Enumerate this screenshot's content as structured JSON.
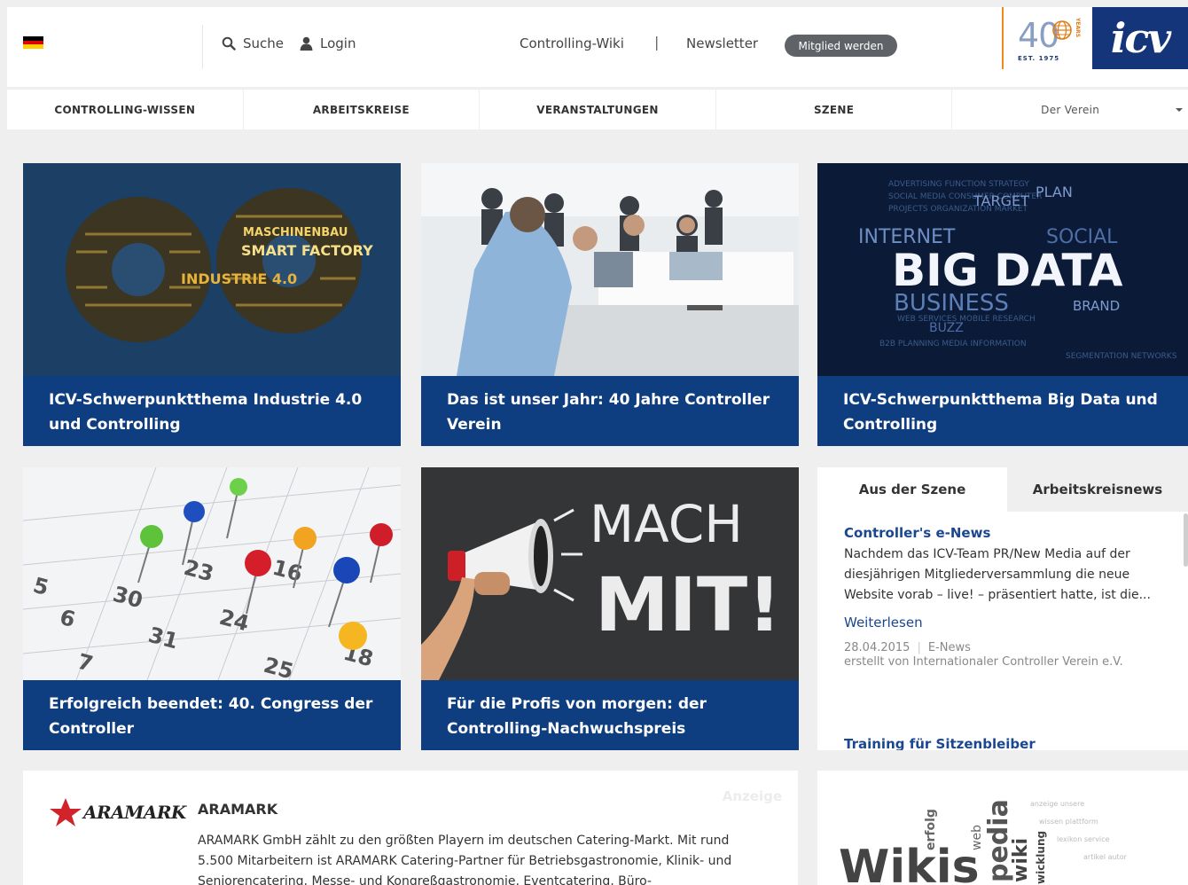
{
  "topbar": {
    "search_label": "Suche",
    "login_label": "Login",
    "wiki_label": "Controlling-Wiki",
    "pipe": "|",
    "newsletter_label": "Newsletter",
    "join_label": "Mitglied werden",
    "logo40": {
      "number": "40",
      "years": "YEARS",
      "est": "EST. 1975"
    },
    "logo_icv": "icv",
    "flag_colors": [
      "#000000",
      "#dd0000",
      "#ffce00"
    ]
  },
  "nav": {
    "items": [
      {
        "label": "CONTROLLING-WISSEN"
      },
      {
        "label": "ARBEITSKREISE"
      },
      {
        "label": "VERANSTALTUNGEN"
      },
      {
        "label": "SZENE"
      },
      {
        "label": "Der Verein"
      }
    ]
  },
  "tiles": [
    {
      "caption": "ICV-Schwerpunktthema Industrie 4.0 und Controlling",
      "image": "gears-word-cloud"
    },
    {
      "caption": "Das ist unser Jahr: 40 Jahre Controller Verein",
      "image": "meeting-photo"
    },
    {
      "caption": "ICV-Schwerpunktthema Big Data und Controlling",
      "image": "big-data-word-cloud"
    },
    {
      "caption": "Erfolgreich beendet: 40. Congress der Controller",
      "image": "calendar-pins"
    },
    {
      "caption": "Für die Profis von morgen: der Controlling-Nachwuchspreis",
      "image": "megaphone-chalkboard"
    }
  ],
  "images": {
    "gears_words": [
      "MASCHINENBAU",
      "SMART FACTORY",
      "INDUSTRIE 4.0"
    ],
    "bigdata_words": [
      "INTERNET",
      "BIG DATA",
      "BUSINESS",
      "TARGET",
      "PLAN",
      "SOCIAL",
      "BRAND",
      "BUZZ"
    ],
    "chalk_words": [
      "MACH",
      "MIT!"
    ],
    "wiki_words": [
      "Wikis",
      "pedia",
      "wiki",
      "erfolg",
      "web",
      "wicklung"
    ]
  },
  "news": {
    "tabs": [
      {
        "label": "Aus der Szene"
      },
      {
        "label": "Arbeitskreisnews"
      }
    ],
    "item1": {
      "title": "Controller's e-News",
      "text": "Nachdem das ICV-Team PR/New Media auf der diesjährigen Mitgliederversammlung die neue Website vorab – live! – präsentiert hatte, ist die...",
      "more": "Weiterlesen",
      "date": "28.04.2015",
      "category": "E-News",
      "author": "erstellt von Internationaler Controller Verein e.V."
    },
    "item2": {
      "title": "Training für Sitzenbleiber"
    }
  },
  "ad": {
    "label": "Anzeige",
    "logo": "ARAMARK",
    "title": "ARAMARK",
    "text": "ARAMARK GmbH zählt zu den größten Playern im deutschen Catering-Markt. Mit rund 5.500 Mitarbeitern ist ARAMARK Catering-Partner für Betriebsgastronomie, Klinik- und Seniorencatering, Messe- und Kongreßgastronomie, Eventcatering, Büro-"
  }
}
